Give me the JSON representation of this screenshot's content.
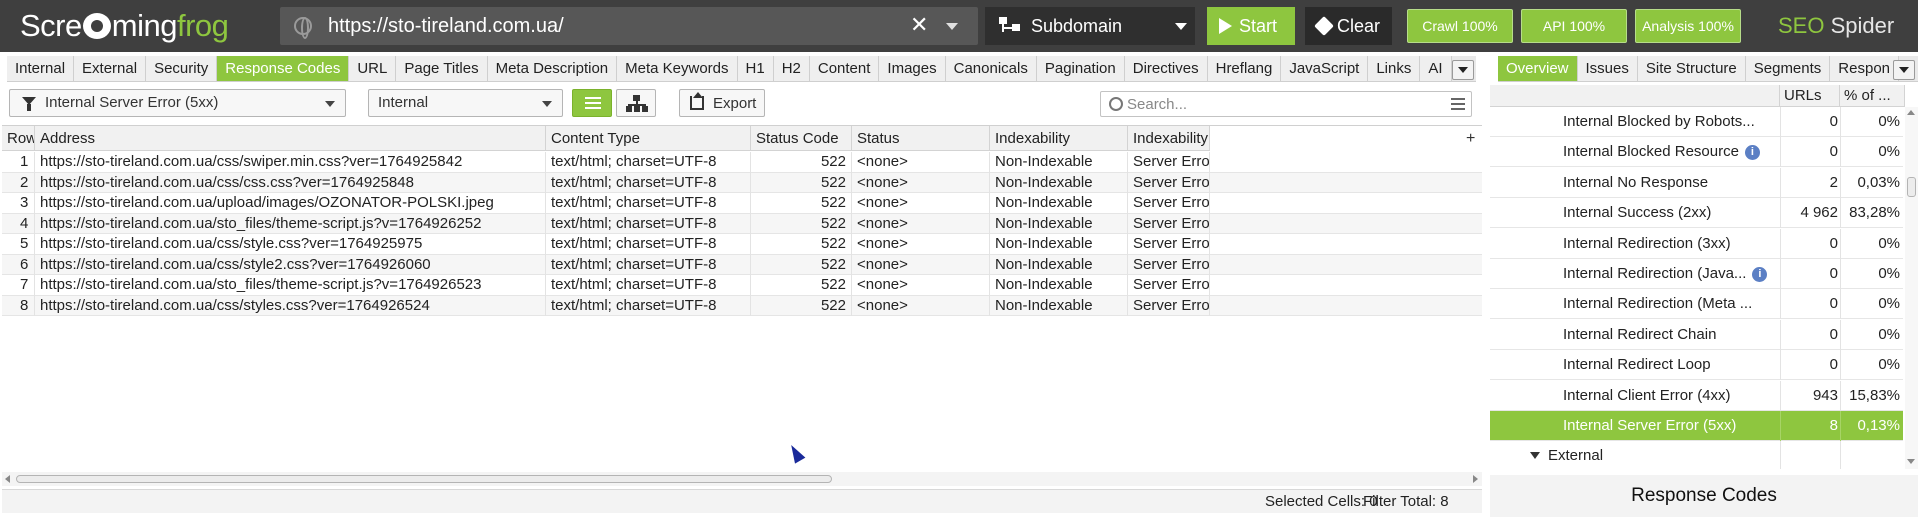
{
  "app": {
    "logo_pre": "Scre",
    "logo_mid": "ming",
    "logo_post": "frog",
    "brand_seo": "SEO",
    "brand_spider": "Spider"
  },
  "header": {
    "url": "https://sto-tireland.com.ua/",
    "mode": "Subdomain",
    "start_label": "Start",
    "clear_label": "Clear",
    "crawl_label": "Crawl 100%",
    "api_label": "API 100%",
    "analysis_label": "Analysis 100%"
  },
  "tabs": {
    "main": [
      "Internal",
      "External",
      "Security",
      "Response Codes",
      "URL",
      "Page Titles",
      "Meta Description",
      "Meta Keywords",
      "H1",
      "H2",
      "Content",
      "Images",
      "Canonicals",
      "Pagination",
      "Directives",
      "Hreflang",
      "JavaScript",
      "Links",
      "AI"
    ],
    "main_active": "Response Codes",
    "side": [
      "Overview",
      "Issues",
      "Site Structure",
      "Segments",
      "Respon"
    ],
    "side_active": "Overview"
  },
  "toolbar": {
    "filter": "Internal Server Error (5xx)",
    "scope": "Internal",
    "export_label": "Export",
    "search_placeholder": "Search..."
  },
  "table": {
    "columns": [
      "Row",
      "Address",
      "Content Type",
      "Status Code",
      "Status",
      "Indexability",
      "Indexability"
    ],
    "rows": [
      [
        "1",
        "https://sto-tireland.com.ua/css/swiper.min.css?ver=1764925842",
        "text/html; charset=UTF-8",
        "522",
        "<none>",
        "Non-Indexable",
        "Server Error"
      ],
      [
        "2",
        "https://sto-tireland.com.ua/css/css.css?ver=1764925848",
        "text/html; charset=UTF-8",
        "522",
        "<none>",
        "Non-Indexable",
        "Server Error"
      ],
      [
        "3",
        "https://sto-tireland.com.ua/upload/images/OZONATOR-POLSKI.jpeg",
        "text/html; charset=UTF-8",
        "522",
        "<none>",
        "Non-Indexable",
        "Server Error"
      ],
      [
        "4",
        "https://sto-tireland.com.ua/sto_files/theme-script.js?v=1764926252",
        "text/html; charset=UTF-8",
        "522",
        "<none>",
        "Non-Indexable",
        "Server Error"
      ],
      [
        "5",
        "https://sto-tireland.com.ua/css/style.css?ver=1764925975",
        "text/html; charset=UTF-8",
        "522",
        "<none>",
        "Non-Indexable",
        "Server Error"
      ],
      [
        "6",
        "https://sto-tireland.com.ua/css/style2.css?ver=1764926060",
        "text/html; charset=UTF-8",
        "522",
        "<none>",
        "Non-Indexable",
        "Server Error"
      ],
      [
        "7",
        "https://sto-tireland.com.ua/sto_files/theme-script.js?v=1764926523",
        "text/html; charset=UTF-8",
        "522",
        "<none>",
        "Non-Indexable",
        "Server Error"
      ],
      [
        "8",
        "https://sto-tireland.com.ua/css/styles.css?ver=1764926524",
        "text/html; charset=UTF-8",
        "522",
        "<none>",
        "Non-Indexable",
        "Server Error"
      ]
    ]
  },
  "status": {
    "selected": "Selected Cells:  0",
    "filter_total": "Filter Total:  8"
  },
  "overview": {
    "col_urls": "URLs",
    "col_pct": "% of ...",
    "items": [
      {
        "name": "Internal Blocked by Robots...",
        "urls": "0",
        "pct": "0%",
        "info": false
      },
      {
        "name": "Internal Blocked Resource",
        "urls": "0",
        "pct": "0%",
        "info": true
      },
      {
        "name": "Internal No Response",
        "urls": "2",
        "pct": "0,03%",
        "info": false
      },
      {
        "name": "Internal Success (2xx)",
        "urls": "4 962",
        "pct": "83,28%",
        "info": false
      },
      {
        "name": "Internal Redirection (3xx)",
        "urls": "0",
        "pct": "0%",
        "info": false
      },
      {
        "name": "Internal Redirection (Java...",
        "urls": "0",
        "pct": "0%",
        "info": true
      },
      {
        "name": "Internal Redirection (Meta ...",
        "urls": "0",
        "pct": "0%",
        "info": false
      },
      {
        "name": "Internal Redirect Chain",
        "urls": "0",
        "pct": "0%",
        "info": false
      },
      {
        "name": "Internal Redirect Loop",
        "urls": "0",
        "pct": "0%",
        "info": false
      },
      {
        "name": "Internal Client Error (4xx)",
        "urls": "943",
        "pct": "15,83%",
        "info": false
      },
      {
        "name": "Internal Server Error (5xx)",
        "urls": "8",
        "pct": "0,13%",
        "info": false,
        "selected": true
      }
    ],
    "group": "External",
    "panel_title": "Response Codes"
  },
  "colors": {
    "accent": "#8ec63f",
    "header_bg": "#3f3f3f"
  }
}
